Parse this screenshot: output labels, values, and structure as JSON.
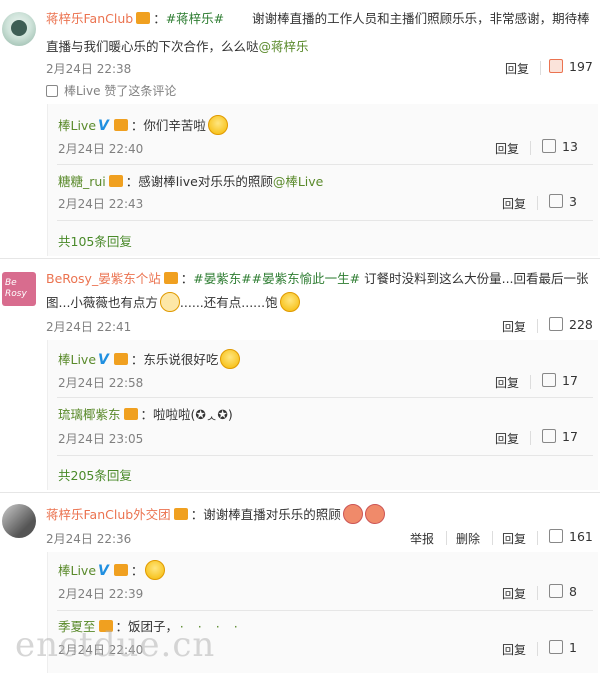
{
  "c1": {
    "user": "蒋梓乐FanClub",
    "tag": "#蒋梓乐#",
    "text1": "谢谢棒直播的工作人员和主播们照顾乐乐，非常感谢，期待棒",
    "text2": "直播与我们暖心乐的下次合作，么么哒",
    "at": "@蒋梓乐",
    "date": "2月24日 22:38",
    "reply": "回复",
    "likes": "197",
    "liked_by": "棒Live 赞了这条评论",
    "r1": {
      "user": "棒Live",
      "text": "：你们辛苦啦",
      "date": "2月24日 22:40",
      "reply": "回复",
      "likes": "13"
    },
    "r2": {
      "user": "糖糖_rui",
      "text": "：感谢棒live对乐乐的照顾",
      "at": "@棒Live",
      "date": "2月24日 22:43",
      "reply": "回复",
      "likes": "3"
    },
    "more": "共105条回复"
  },
  "c2": {
    "avatar": "Be Rosy",
    "user": "BeRosy_晏紫东个站",
    "tag1": "#晏紫东#",
    "tag2": "#晏紫东愉此一生#",
    "text1": " 订餐时没料到这么大份量...回看最后一张",
    "text2a": "图...小薇薇也有点方",
    "text2b": "......还有点......饱",
    "date": "2月24日 22:41",
    "reply": "回复",
    "likes": "228",
    "r1": {
      "user": "棒Live",
      "text": "：东乐说很好吃",
      "date": "2月24日 22:58",
      "reply": "回复",
      "likes": "17"
    },
    "r2": {
      "user": "琉璃椰紫东",
      "text": "：啦啦啦(✪ᆺ✪)",
      "date": "2月24日 23:05",
      "reply": "回复",
      "likes": "17"
    },
    "more": "共205条回复"
  },
  "c3": {
    "user": "蒋梓乐FanClub外交团",
    "text": "：谢谢棒直播对乐乐的照顾",
    "date": "2月24日 22:36",
    "report": "举报",
    "delete": "删除",
    "reply": "回复",
    "likes": "161",
    "r1": {
      "user": "棒Live",
      "text": "：",
      "date": "2月24日 22:39",
      "reply": "回复",
      "likes": "8"
    },
    "r2": {
      "user": "季夏至",
      "text": "：饭团子，",
      "date": "2月24日 22:40",
      "reply": "回复",
      "likes": "1"
    }
  },
  "watermark": "enctdue.cn"
}
